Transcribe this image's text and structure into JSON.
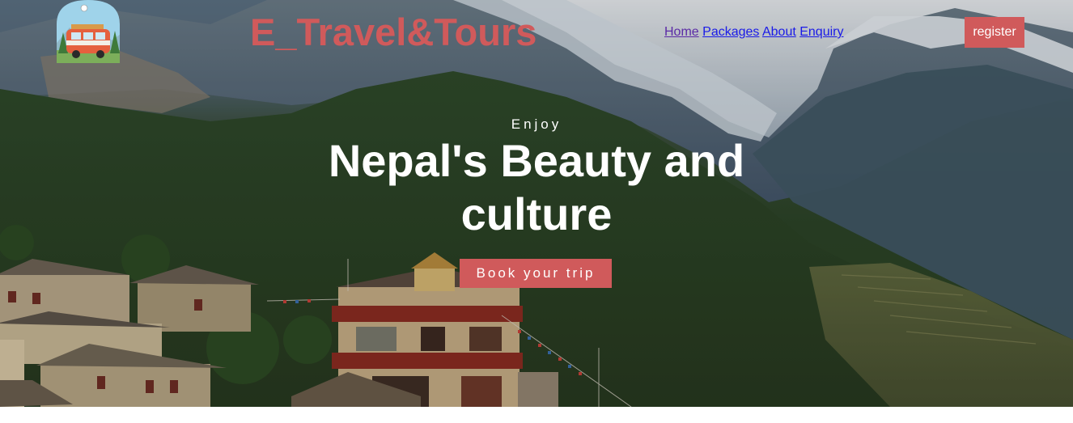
{
  "header": {
    "brand": "E_Travel&Tours",
    "nav": [
      {
        "label": "Home"
      },
      {
        "label": "Packages"
      },
      {
        "label": "About"
      },
      {
        "label": "Enquiry"
      }
    ],
    "register_label": "register"
  },
  "hero": {
    "kicker": "Enjoy",
    "headline": "Nepal's Beauty and culture",
    "cta_label": "Book your trip"
  },
  "colors": {
    "accent": "#d05a5b",
    "link": "#1a1ae8",
    "link_visited": "#5b2aa6",
    "text_on_hero": "#ffffff"
  },
  "icons": {
    "logo": "camper-van-logo"
  }
}
